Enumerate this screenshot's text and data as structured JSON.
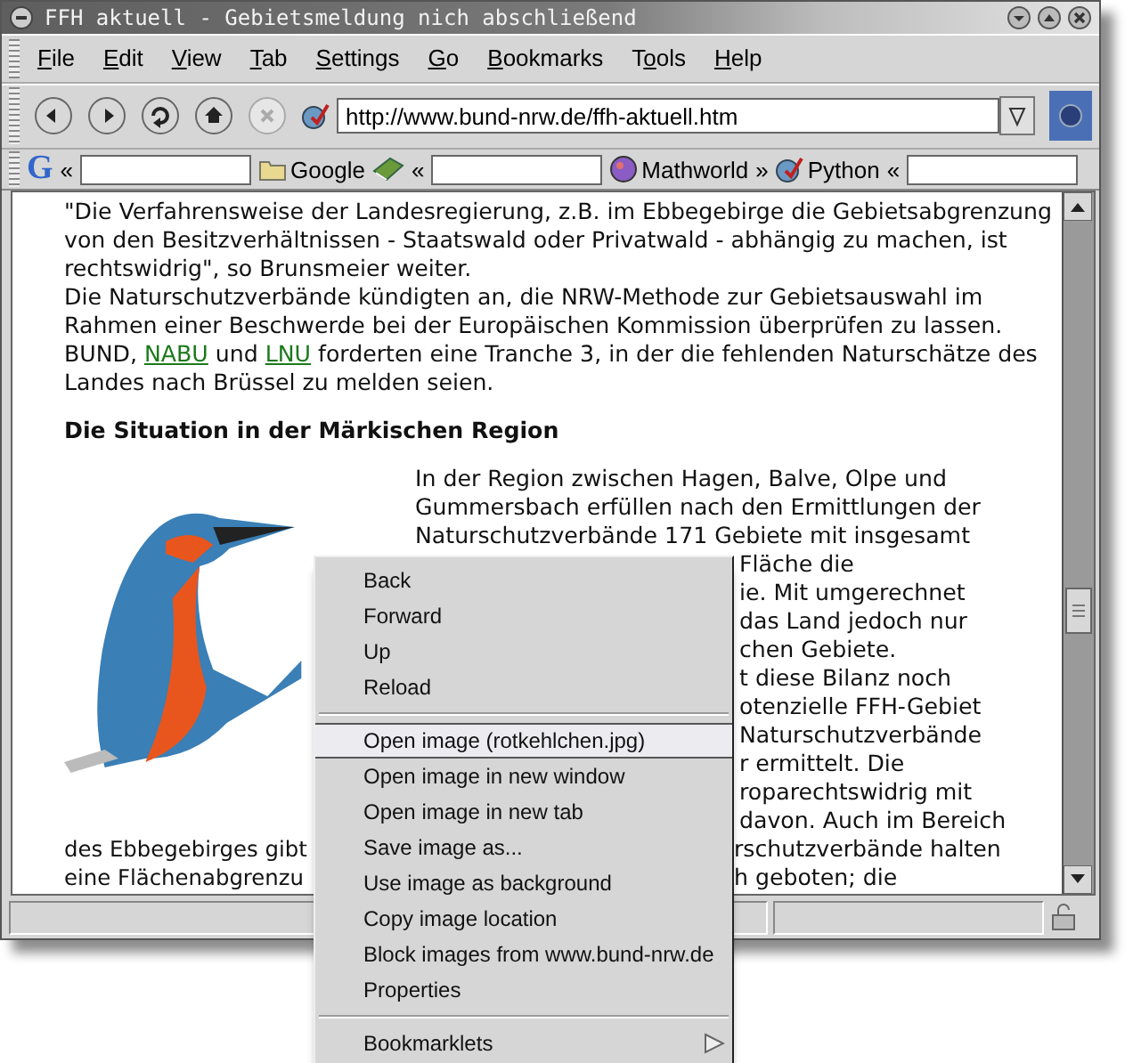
{
  "window": {
    "title": "FFH aktuell - Gebietsmeldung nich abschließend"
  },
  "menu_bar": [
    {
      "key": "F",
      "after": "ile"
    },
    {
      "key": "E",
      "after": "dit"
    },
    {
      "key": "V",
      "after": "iew"
    },
    {
      "key": "T",
      "after": "ab"
    },
    {
      "key": "S",
      "after": "ettings"
    },
    {
      "key": "G",
      "after": "o"
    },
    {
      "key": "B",
      "after": "ookmarks"
    },
    {
      "before": "T",
      "key": "o",
      "after": "ols"
    },
    {
      "key": "H",
      "after": "elp"
    }
  ],
  "nav_bar": {
    "buttons": [
      {
        "kind": "back",
        "disabled": false
      },
      {
        "kind": "forward",
        "disabled": false
      },
      {
        "kind": "reload",
        "disabled": false
      },
      {
        "kind": "home",
        "disabled": false
      },
      {
        "kind": "stop",
        "disabled": true
      }
    ],
    "url": "http://www.bund-nrw.de/ffh-aktuell.htm"
  },
  "bookmark_bar": [
    {
      "kind": "logo",
      "label": "G"
    },
    {
      "kind": "chevron",
      "label": "«"
    },
    {
      "kind": "field"
    },
    {
      "kind": "folder",
      "label": "Google"
    },
    {
      "kind": "book"
    },
    {
      "kind": "chevron",
      "label": "«"
    },
    {
      "kind": "field"
    },
    {
      "kind": "globe",
      "label": "Mathworld"
    },
    {
      "kind": "chevron",
      "label": "»"
    },
    {
      "kind": "bookmark",
      "label": "Python"
    },
    {
      "kind": "chevron",
      "label": "«"
    },
    {
      "kind": "field"
    }
  ],
  "content": {
    "paragraph_1": "\"Die Verfahrensweise der Landesregierung, z.B. im Ebbegebirge die Gebietsabgrenzung von den Besitzverhältnissen - Staatswald oder Privatwald - abhängig zu machen, ist rechtswidrig\", so Brunsmeier weiter.",
    "paragraph_2": [
      {
        "kind": "text",
        "text": "Die Naturschutzverbände kündigten an, die NRW-Methode zur Gebietsauswahl im Rahmen einer Beschwerde bei der Europäischen Kommission überprüfen zu lassen. BUND, "
      },
      {
        "kind": "link",
        "text": "NABU"
      },
      {
        "kind": "text",
        "text": " und "
      },
      {
        "kind": "link",
        "text": "LNU"
      },
      {
        "kind": "text",
        "text": " forderten eine Tranche 3, in der die fehlenden Naturschätze des Landes nach Brüssel zu melden seien."
      }
    ],
    "heading": "Die Situation in der Märkischen Region",
    "column_lines": [
      {
        "kind": "full",
        "text": "In der Region zwischen Hagen, Balve, Olpe und"
      },
      {
        "kind": "full",
        "text": "Gummersbach erfüllen nach den Ermittlungen der"
      },
      {
        "kind": "full",
        "text": "Naturschutzverbände 171 Gebiete mit insgesamt"
      },
      {
        "kind": "tail",
        "text": "Fläche die"
      },
      {
        "kind": "tail",
        "text": "ie. Mit umgerechnet"
      },
      {
        "kind": "tail",
        "text": "das Land jedoch nur"
      },
      {
        "kind": "tail",
        "text": "chen Gebiete."
      },
      {
        "kind": "tail",
        "text": "t diese Bilanz noch"
      },
      {
        "kind": "tail",
        "text": "otenzielle FFH-Gebiet"
      },
      {
        "kind": "tail",
        "text": "Naturschutzverbände"
      },
      {
        "kind": "tail",
        "text": "r ermittelt. Die"
      },
      {
        "kind": "tail",
        "text": "roparechtswidrig mit"
      },
      {
        "kind": "tail",
        "text": "davon. Auch im Bereich"
      }
    ],
    "bottom_lines": [
      {
        "left": "des Ebbegebirges gibt",
        "right": "rschutzverbände halten"
      },
      {
        "left": "eine Flächenabgrenzu",
        "right": "h geboten; die"
      }
    ]
  },
  "context_menu": [
    {
      "kind": "item",
      "label": "Back",
      "selected": false
    },
    {
      "kind": "item",
      "label": "Forward",
      "selected": false
    },
    {
      "kind": "item",
      "label": "Up",
      "selected": false
    },
    {
      "kind": "item",
      "label": "Reload",
      "selected": false
    },
    {
      "kind": "separator"
    },
    {
      "kind": "item",
      "label": "Open image (rotkehlchen.jpg)",
      "selected": true
    },
    {
      "kind": "item",
      "label": "Open image in new window",
      "selected": false
    },
    {
      "kind": "item",
      "label": "Open image in new tab",
      "selected": false
    },
    {
      "kind": "item",
      "label": "Save image as...",
      "selected": false
    },
    {
      "kind": "item",
      "label": "Use image as background",
      "selected": false
    },
    {
      "kind": "item",
      "label": "Copy image location",
      "selected": false
    },
    {
      "kind": "item",
      "label": "Block images from www.bund-nrw.de",
      "selected": false
    },
    {
      "kind": "item",
      "label": "Properties",
      "selected": false
    },
    {
      "kind": "separator"
    },
    {
      "kind": "submenu",
      "label": "Bookmarklets",
      "selected": false
    }
  ]
}
